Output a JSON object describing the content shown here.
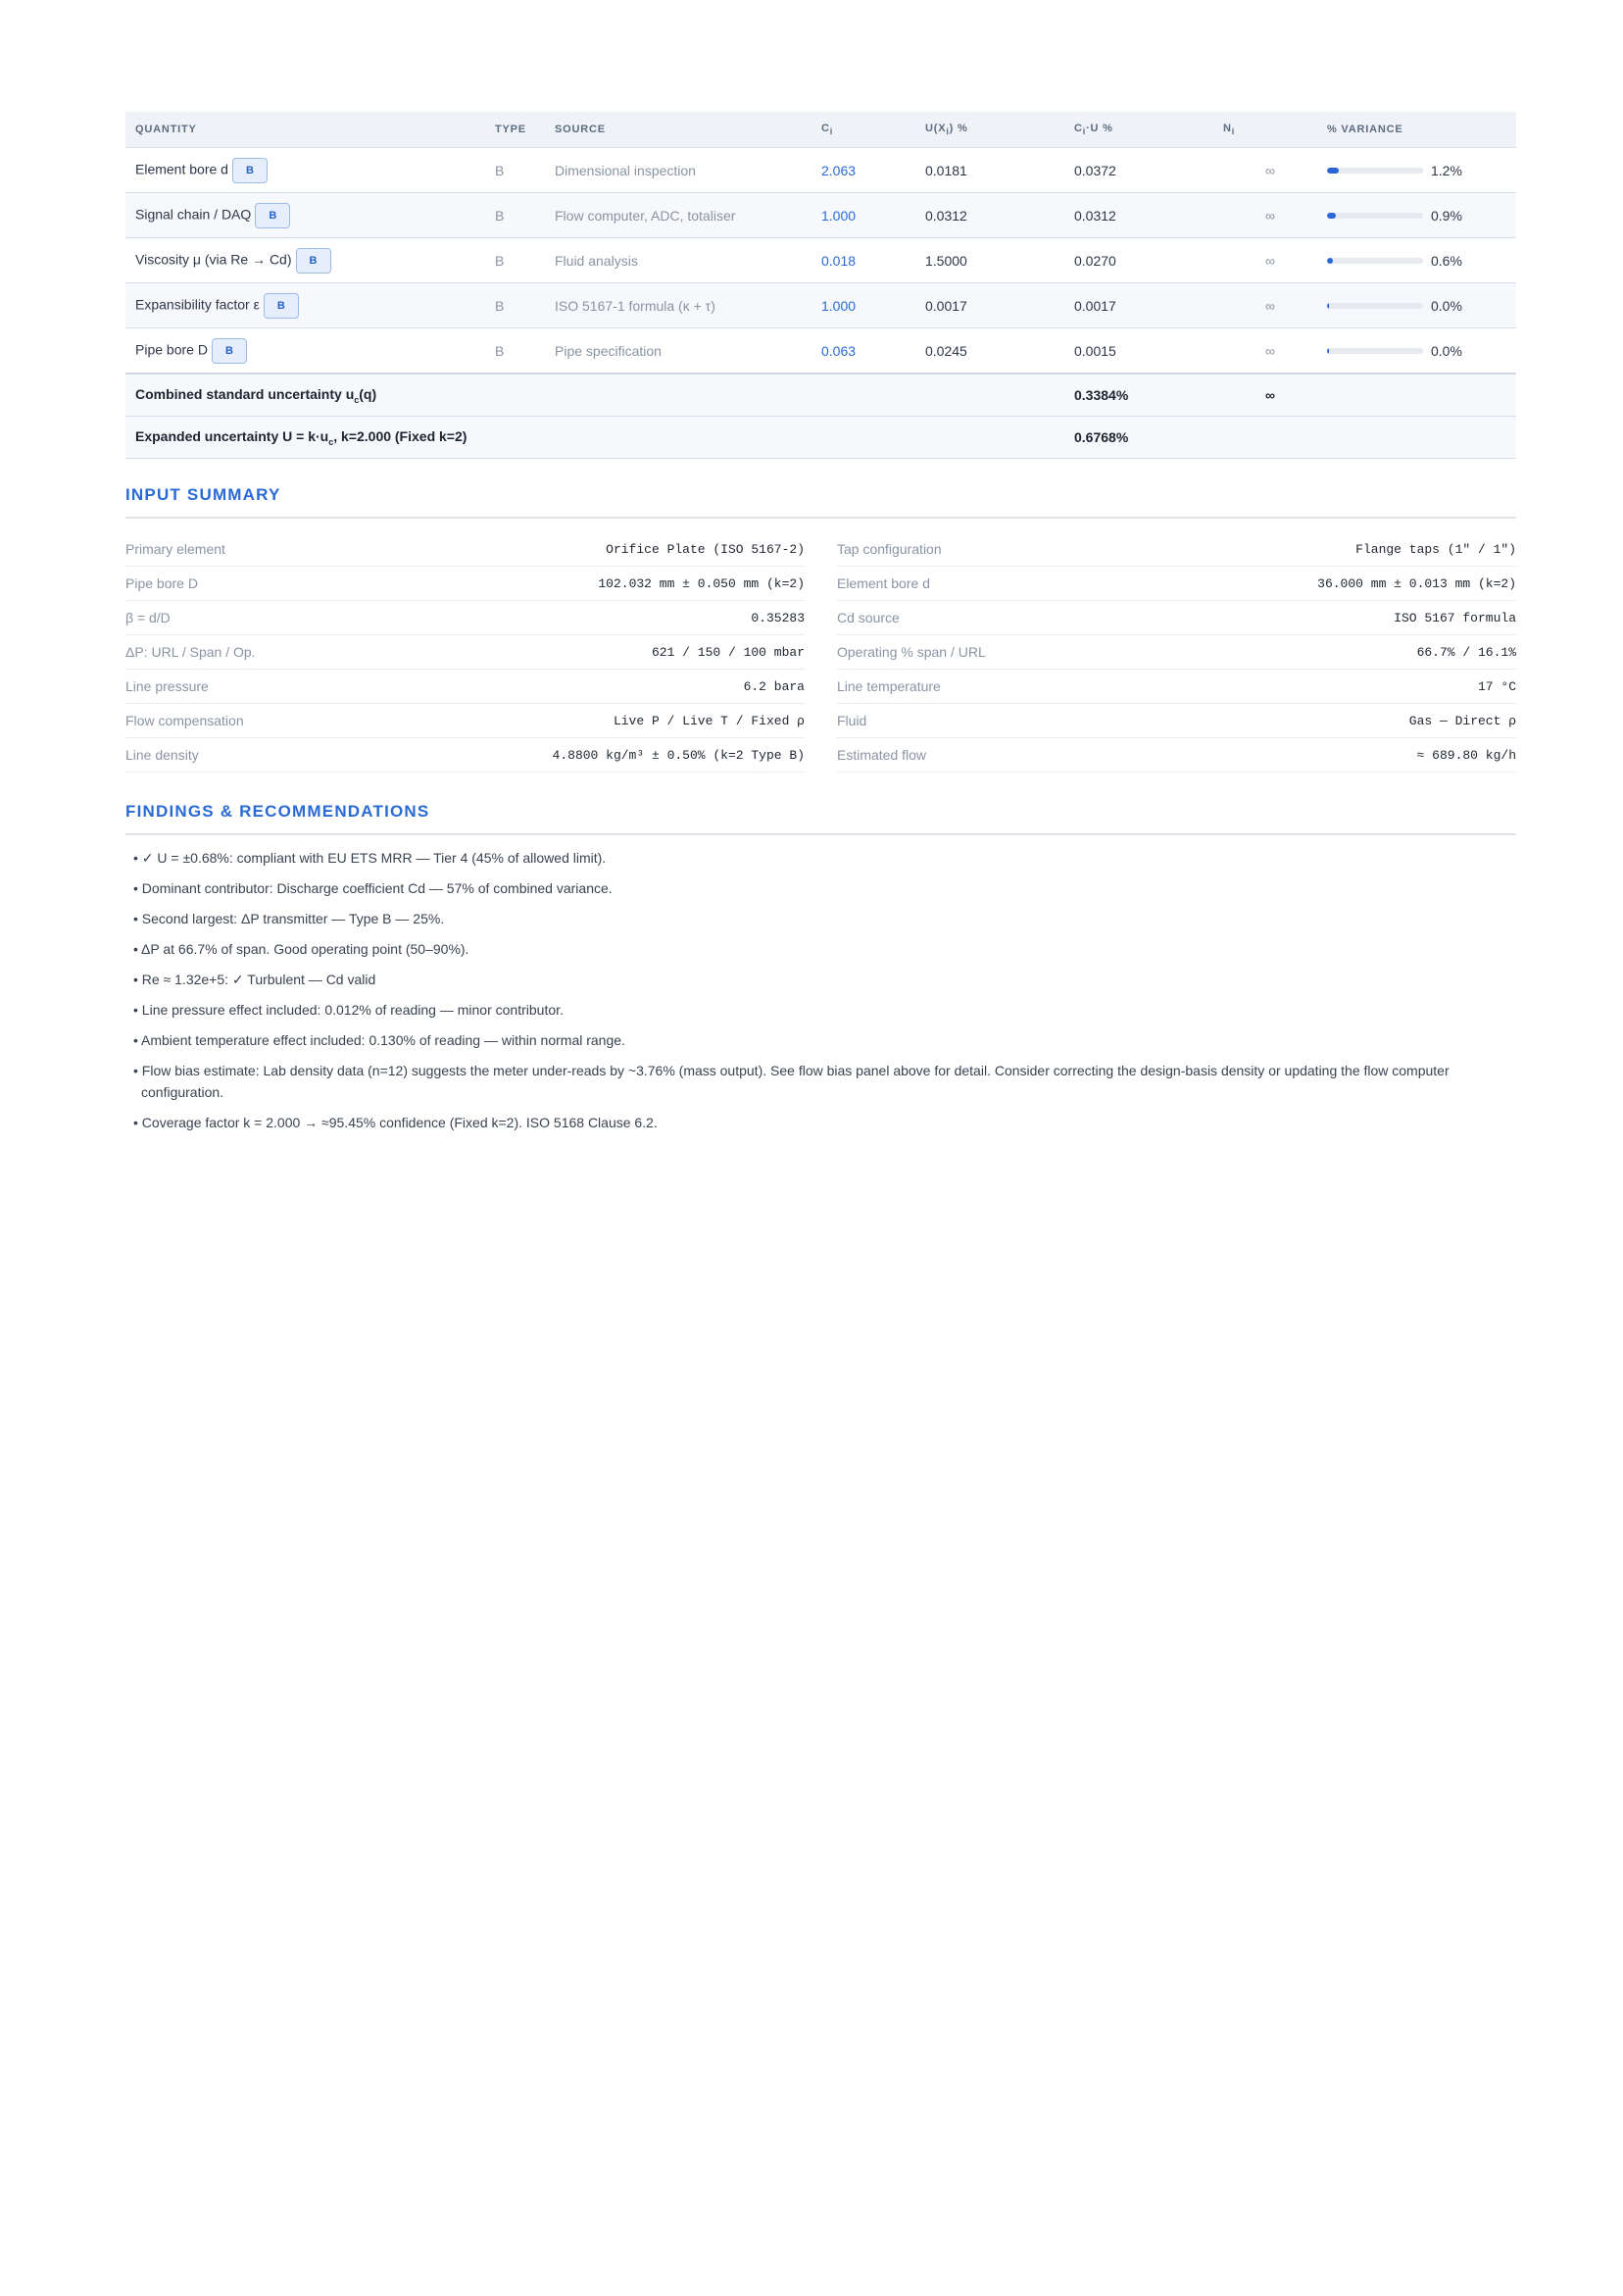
{
  "budget": {
    "headers": {
      "quantity": "QUANTITY",
      "type": "TYPE",
      "source": "SOURCE",
      "ci": "C",
      "ci_sub": "i",
      "u_pre": "U(X",
      "u_sub": "i",
      "u_post": ") %",
      "ciu_pre": "C",
      "ciu_sub": "i",
      "ciu_post": "·U %",
      "ni": "N",
      "ni_sub": "i",
      "variance": "% VARIANCE"
    },
    "rows": [
      {
        "quantity": "Element bore d",
        "badge": "B",
        "type": "B",
        "source": "Dimensional inspection",
        "ci": "2.063",
        "u": "0.0181",
        "ciu": "0.0372",
        "ni": "∞",
        "variance_pct": 1.2,
        "variance_label": "1.2%"
      },
      {
        "quantity": "Signal chain / DAQ",
        "badge": "B",
        "type": "B",
        "source": "Flow computer, ADC, totaliser",
        "ci": "1.000",
        "u": "0.0312",
        "ciu": "0.0312",
        "ni": "∞",
        "variance_pct": 0.9,
        "variance_label": "0.9%"
      },
      {
        "quantity": "Viscosity μ (via Re → Cd)",
        "badge": "B",
        "type": "B",
        "source": "Fluid analysis",
        "ci": "0.018",
        "u": "1.5000",
        "ciu": "0.0270",
        "ni": "∞",
        "variance_pct": 0.6,
        "variance_label": "0.6%"
      },
      {
        "quantity": "Expansibility factor ε",
        "badge": "B",
        "type": "B",
        "source": "ISO 5167-1 formula (κ + τ)",
        "ci": "1.000",
        "u": "0.0017",
        "ciu": "0.0017",
        "ni": "∞",
        "variance_pct": 0.0,
        "variance_label": "0.0%"
      },
      {
        "quantity": "Pipe bore D",
        "badge": "B",
        "type": "B",
        "source": "Pipe specification",
        "ci": "0.063",
        "u": "0.0245",
        "ciu": "0.0015",
        "ni": "∞",
        "variance_pct": 0.0,
        "variance_label": "0.0%"
      }
    ],
    "combined": {
      "label_pre": "Combined standard uncertainty u",
      "label_sub": "c",
      "label_post": "(q)",
      "value": "0.3384%",
      "ni": "∞"
    },
    "expanded": {
      "label_pre": "Expanded uncertainty U = k·u",
      "label_sub": "c",
      "label_post": ", k=2.000 (Fixed k=2)",
      "value": "0.6768%"
    }
  },
  "input_summary": {
    "title": "INPUT SUMMARY",
    "left": [
      {
        "label": "Primary element",
        "value": "Orifice Plate (ISO 5167-2)"
      },
      {
        "label": "Pipe bore D",
        "value": "102.032 mm ± 0.050 mm (k=2)"
      },
      {
        "label": "β = d/D",
        "value": "0.35283"
      },
      {
        "label": "ΔP: URL / Span / Op.",
        "value": "621 / 150 / 100 mbar"
      },
      {
        "label": "Line pressure",
        "value": "6.2 bara"
      },
      {
        "label": "Flow compensation",
        "value": "Live P / Live T / Fixed ρ"
      },
      {
        "label": "Line density",
        "value": "4.8800 kg/m³ ± 0.50% (k=2 Type B)"
      }
    ],
    "right": [
      {
        "label": "Tap configuration",
        "value": "Flange taps (1\" / 1\")"
      },
      {
        "label": "Element bore d",
        "value": "36.000 mm ± 0.013 mm (k=2)"
      },
      {
        "label": "Cd source",
        "value": "ISO 5167 formula"
      },
      {
        "label": "Operating % span / URL",
        "value": "66.7% / 16.1%"
      },
      {
        "label": "Line temperature",
        "value": "17 °C"
      },
      {
        "label": "Fluid",
        "value": "Gas — Direct ρ"
      },
      {
        "label": "Estimated flow",
        "value": "≈ 689.80 kg/h"
      }
    ]
  },
  "findings": {
    "title": "FINDINGS & RECOMMENDATIONS",
    "items": [
      "• ✓ U = ±0.68%: compliant with EU ETS MRR — Tier 4 (45% of allowed limit).",
      "• Dominant contributor: Discharge coefficient Cd — 57% of combined variance.",
      "• Second largest: ΔP transmitter — Type B — 25%.",
      "• ΔP at 66.7% of span. Good operating point (50–90%).",
      "• Re ≈ 1.32e+5: ✓ Turbulent — Cd valid",
      "• Line pressure effect included: 0.012% of reading — minor contributor.",
      "• Ambient temperature effect included: 0.130% of reading — within normal range.",
      "• Flow bias estimate: Lab density data (n=12) suggests the meter under-reads by ~3.76% (mass output). See flow bias panel above for detail. Consider correcting the design-basis density or updating the flow computer configuration.",
      "• Coverage factor k = 2.000 → ≈95.45% confidence (Fixed k=2). ISO 5168 Clause 6.2."
    ]
  }
}
